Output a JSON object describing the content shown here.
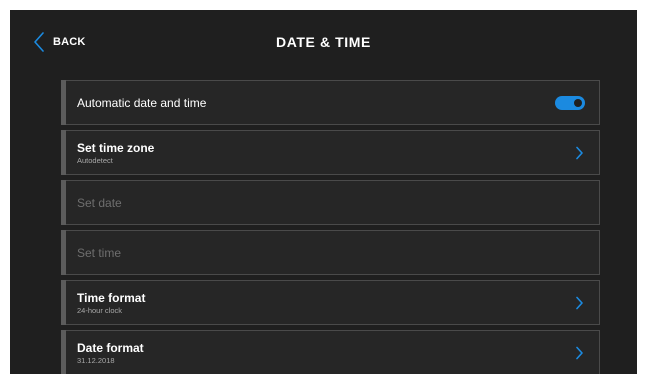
{
  "header": {
    "back_label": "BACK",
    "title": "DATE & TIME"
  },
  "rows": [
    {
      "label": "Automatic date and time",
      "control": "toggle",
      "toggle_on": true
    },
    {
      "label": "Set time zone",
      "sublabel": "Autodetect",
      "control": "chevron-right-icon"
    },
    {
      "label": "Set date",
      "disabled": true
    },
    {
      "label": "Set time",
      "disabled": true
    },
    {
      "label": "Time format",
      "sublabel": "24-hour clock",
      "control": "chevron-right-icon"
    },
    {
      "label": "Date format",
      "sublabel": "31.12.2018",
      "control": "chevron-right-icon"
    }
  ],
  "colors": {
    "accent": "#1b8ae0",
    "background": "#1f1f1f",
    "row_background": "#262626",
    "row_border": "#4a4a4a",
    "disabled_text": "#6e6e6e"
  }
}
